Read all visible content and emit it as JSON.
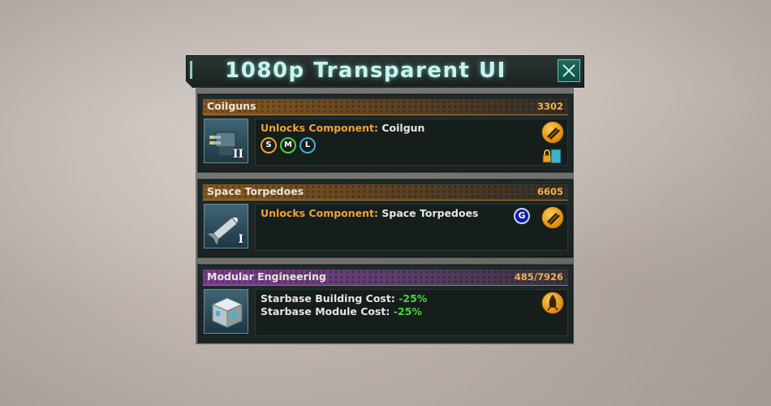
{
  "window": {
    "title": "1080p Transparent UI"
  },
  "cards": [
    {
      "name": "Coilguns",
      "cost": "3302",
      "tier": "II",
      "line1_label": "Unlocks Component:",
      "line1_value": "Coilgun",
      "sizes": [
        "S",
        "M",
        "L"
      ]
    },
    {
      "name": "Space Torpedoes",
      "cost": "6605",
      "tier": "I",
      "line1_label": "Unlocks Component:",
      "line1_value": "Space Torpedoes",
      "badge": "G"
    },
    {
      "name": "Modular Engineering",
      "cost": "485/7926",
      "line1_label": "Starbase Building Cost:",
      "line1_value": "-25%",
      "line2_label": "Starbase Module Cost:",
      "line2_value": "-25%"
    }
  ],
  "colors": {
    "physics_header": "#8a5a1f",
    "engineering_header": "#7c3f93",
    "label_orange": "#f0a13a",
    "bonus_green": "#4ed13f",
    "title_cyan": "#c9f3ec"
  },
  "icons": [
    "close-icon",
    "weapon-category-icon",
    "locked-icon",
    "ship-category-icon",
    "coilgun-turret-icon",
    "torpedo-icon",
    "starbase-module-icon"
  ]
}
